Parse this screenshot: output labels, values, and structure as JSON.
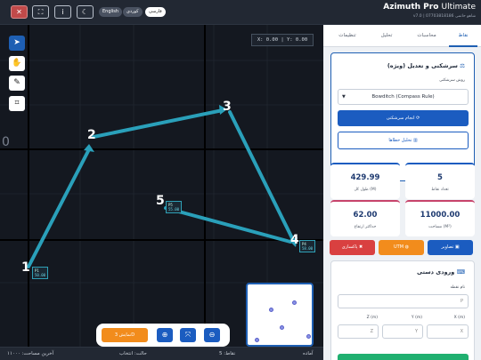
{
  "header": {
    "app_title_bold": "Azimuth Pro",
    "app_title_light": "Ultimate",
    "subtitle": "v7.0 | 07703818186 شاهو حاتمی",
    "buttons": [
      "✕",
      "⛶",
      "i",
      "☾"
    ],
    "languages": [
      "English",
      "کوردی",
      "فارسی"
    ],
    "active_language": "فارسی"
  },
  "canvas": {
    "coords": "X: 0.00 | Y: 0.00",
    "axis_label": "0",
    "tools": [
      "pointer-icon",
      "hand-icon",
      "ruler-icon",
      "polygon-icon"
    ],
    "points": [
      {
        "label": "1",
        "tag": "P1",
        "elev": "50.00"
      },
      {
        "label": "2"
      },
      {
        "label": "3"
      },
      {
        "label": "4",
        "tag": "P4",
        "elev": "58.00"
      },
      {
        "label": "5",
        "tag": "P5",
        "elev": "55.00"
      }
    ],
    "bottom_tools": {
      "view3d": "نمایش 3D",
      "zoom_in": "zoom-in-icon",
      "fit": "fit-icon",
      "zoom_out": "zoom-out-icon"
    }
  },
  "status": {
    "ready": "آماده",
    "points": "نقاط: 5",
    "mode": "حالت: انتخاب",
    "last_area": "آخرین مساحت: ۱۱۰۰۰"
  },
  "panel": {
    "tabs": [
      "نقاط",
      "محاسبات",
      "تحلیل",
      "تنظیمات"
    ],
    "active_tab": "نقاط",
    "survey": {
      "title": "سرشکنی و تعدیل (ویژه)",
      "method_label": "روش سرشکنی",
      "method_value": "Bowditch (Compass Rule)",
      "run_button": "انجام سرشکنی",
      "analyze_button": "تحلیل خطاها"
    },
    "stats": [
      {
        "value": "5",
        "label": "تعداد نقاط"
      },
      {
        "value": "429.99",
        "label": "طول کل (M)"
      },
      {
        "value": "11000.00",
        "label": "مساحت (M²)"
      },
      {
        "value": "62.00",
        "label": "حداکثر ارتفاع"
      }
    ],
    "actions": {
      "edit": "تصاویر",
      "utm": "UTM",
      "clear": "پاکسازی"
    },
    "manual": {
      "title": "ورودی دستی",
      "name_label": "نام نقطه",
      "name_placeholder": "P",
      "x_label": "X (m)",
      "y_label": "Y (m)",
      "z_label": "Z (m)",
      "x_placeholder": "X",
      "y_placeholder": "Y",
      "z_placeholder": "Z"
    }
  }
}
